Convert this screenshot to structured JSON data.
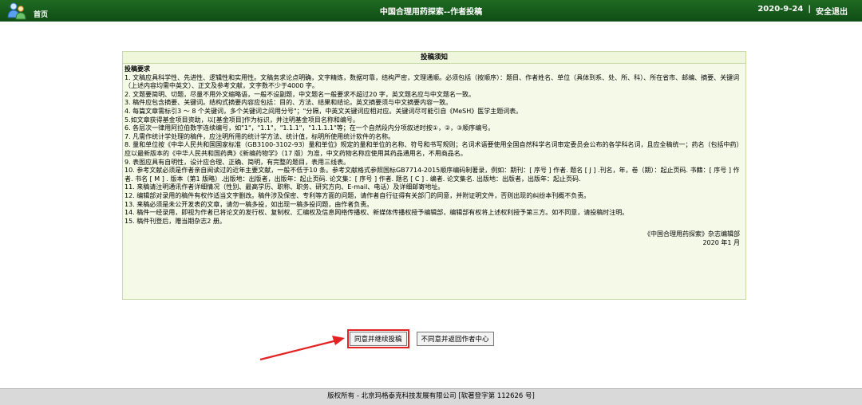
{
  "header": {
    "home_label": "首页",
    "title": "中国合理用药探索--作者投稿",
    "date": "2020-9-24",
    "separator": "|",
    "logout": "安全退出"
  },
  "notice": {
    "title": "投稿须知",
    "subtitle": "投稿要求",
    "items": [
      "1. 文稿应具科学性、先进性、逻辑性和实用性。文稿务求论点明确，文字精炼，数据可靠，结构严密，文理通顺。必须包括（按顺序）：题目、作者姓名、单位（具体到系、处、所、科）、所在省市、邮编、摘要、关键词（上述内容均需中英文）、正文及参考文献，文字数不少于4000 字。",
      "2. 文题要简明、切题，尽量不用外文缩略语，一般不设副题，中文题名一般要求不超过20 字，英文题名应与中文题名一致。",
      "3. 稿件应包含摘要、关键词。结构式摘要内容应包括：目的、方法、结果和结论。英文摘要须与中文摘要内容一致。",
      "4. 每篇文章需标引3 ～ 8 个关键词，多个关键词之间用分号\"；\"分隔，中英文关键词应相对应。关键词尽可能引自《MeSH》医学主题词表。",
      "5.如文章获得基金项目资助，以[基金项目]作为标识，并注明基金项目名称和编号。",
      "6. 各层次一律用阿拉伯数字连续编号，如\"1\"，\"1.1\"，\"1.1.1\"，\"1.1.1.1\"等；在一个自然段内分项叙述时按①，②，③顺序编号。",
      "7. 凡需作统计学处理的稿件，应注明所用的统计学方法、统计值，标明所使用统计软件的名称。",
      "8. 量和单位按《中华人民共和国国家标准（GB3100-3102-93）量和单位》规定的量和单位的名称、符号和书写规则；名词术语要使用全国自然科学名词审定委员会公布的各学科名词，且应全稿统一；药名（包括中药）应以最新版本的《中华人民共和国药典》《新编药物学》（17 版）为准，中文药物名称应使用其药品通用名，不用商品名。",
      "9. 表图应具有自明性，设计应合理、正确、简明，有完整的题目，表用三线表。",
      "10. 参考文献必须是作者亲自阅读过的近年主要文献，一般不低于10 条。参考文献格式参照国标GB7714-2015顺序编码制著录，例如：期刊：[ 序号 ] 作者. 题名 [ J ] .刊名，年，卷（期）：起止页码. 书籍：[ 序号 ] 作者. 书名 [ M ] . 版本（第1 版略）.出版地：出版者，出版年：起止页码. 论文集：[ 序号 ] 作者. 题名 [ C ] . 编者. 论文集名. 出版地：出版者，出版年：起止页码.",
      "11. 来稿请注明通讯作者详细情况（性别、最高学历、职称、职务、研究方向、E-mail、电话）及详细邮寄地址。",
      "12. 编辑部对录用的稿件有权作适当文字删改。稿件涉及保密、专利等方面的问题，请作者自行征得有关部门的同意，并附证明文件，否则出现的纠纷本刊概不负责。",
      "13. 来稿必须是未公开发表的文章，请勿一稿多投，如出现一稿多投问题，由作者负责。",
      "14. 稿件一经录用，即视为作者已将论文的发行权、复制权、汇编权及信息网络传播权、新媒体传播权授予编辑部，编辑部有权将上述权利授予第三方。如不同意，请投稿时注明。",
      "15. 稿件刊登后，赠当期杂志2 册。"
    ],
    "signoff_org": "《中国合理用药探索》杂志编辑部",
    "signoff_date": "2020 年1 月"
  },
  "buttons": {
    "agree": "同意并继续投稿",
    "disagree": "不同意并返回作者中心"
  },
  "footer": {
    "text": "版权所有 - 北京玛格泰克科技发展有限公司 [软著登字第 112626 号]"
  },
  "colors": {
    "header_bg": "#1f6a23",
    "notice_bg": "#f5fae8",
    "notice_border": "#c7d9a6",
    "highlight_red": "#e32222",
    "footer_bg": "#d9d9d9"
  },
  "icons": {
    "home": "users-icon",
    "annotation": "red-arrow-icon"
  }
}
